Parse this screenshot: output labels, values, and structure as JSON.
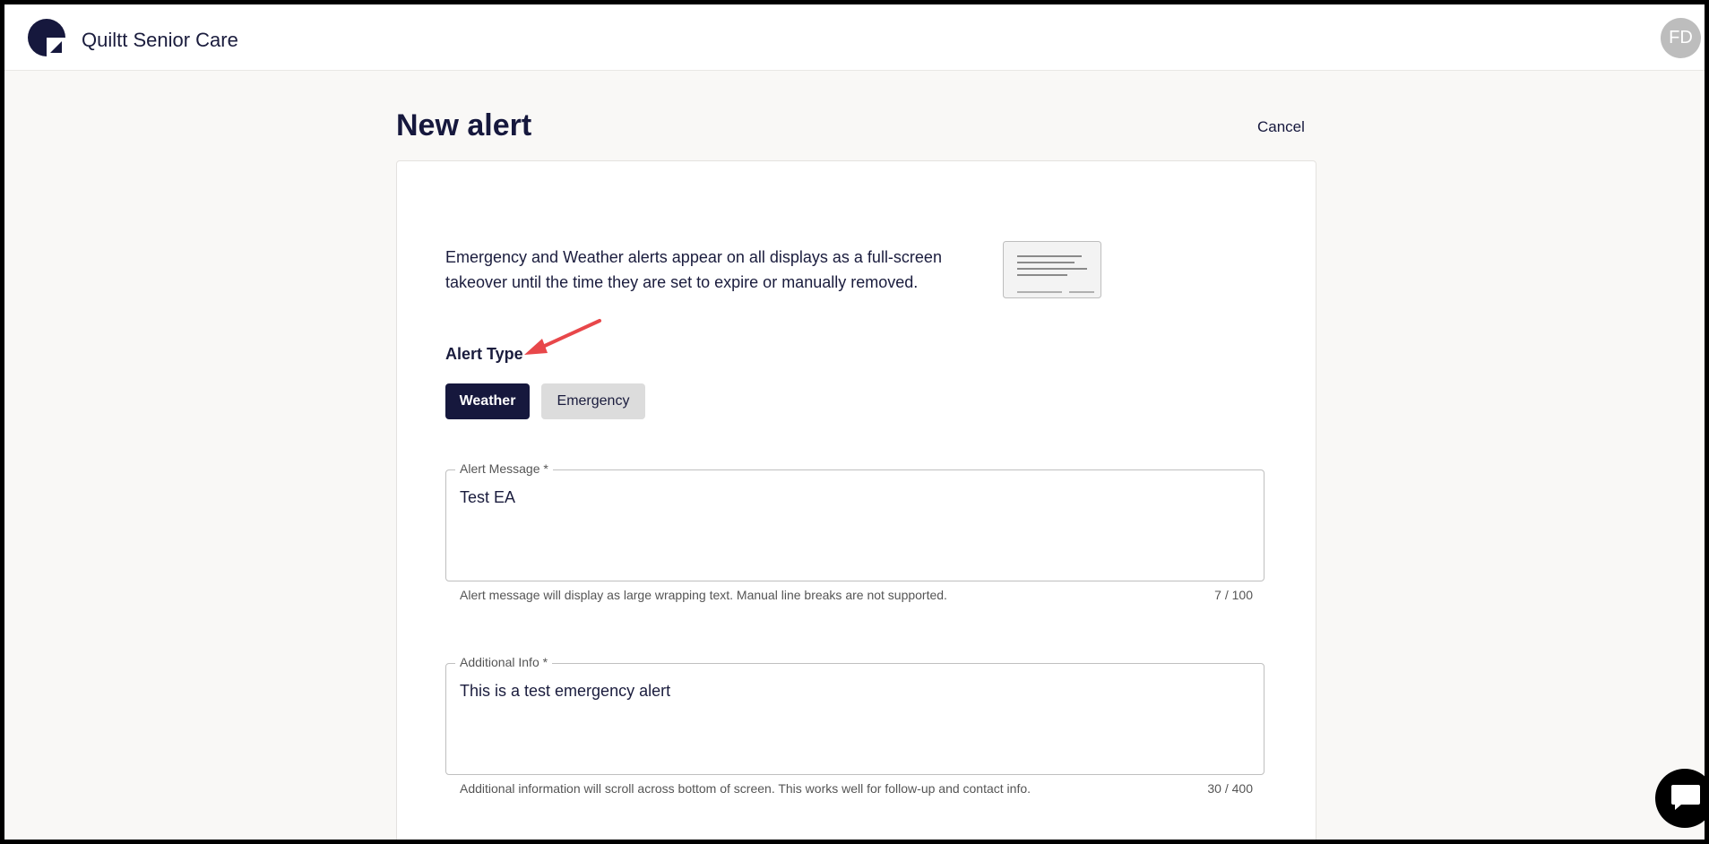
{
  "header": {
    "app_title": "Quiltt Senior Care",
    "avatar_initials": "FD"
  },
  "page": {
    "title": "New alert",
    "cancel_label": "Cancel"
  },
  "form": {
    "intro_text": "Emergency and Weather alerts appear on all displays as a full-screen takeover until the time they are set to expire or manually removed.",
    "alert_type_label": "Alert Type",
    "alert_types": [
      {
        "label": "Weather",
        "selected": true
      },
      {
        "label": "Emergency",
        "selected": false
      }
    ],
    "alert_message": {
      "label": "Alert Message *",
      "value": "Test EA",
      "helper": "Alert message will display as large wrapping text. Manual line breaks are not supported.",
      "counter": "7 / 100"
    },
    "additional_info": {
      "label": "Additional Info *",
      "value": "This is a test emergency alert",
      "helper": "Additional information will scroll across bottom of screen. This works well for follow-up and contact info.",
      "counter": "30 / 400"
    }
  },
  "colors": {
    "primary": "#16183d",
    "annotation_arrow": "#e8474a",
    "page_bg": "#f9f8f6"
  }
}
